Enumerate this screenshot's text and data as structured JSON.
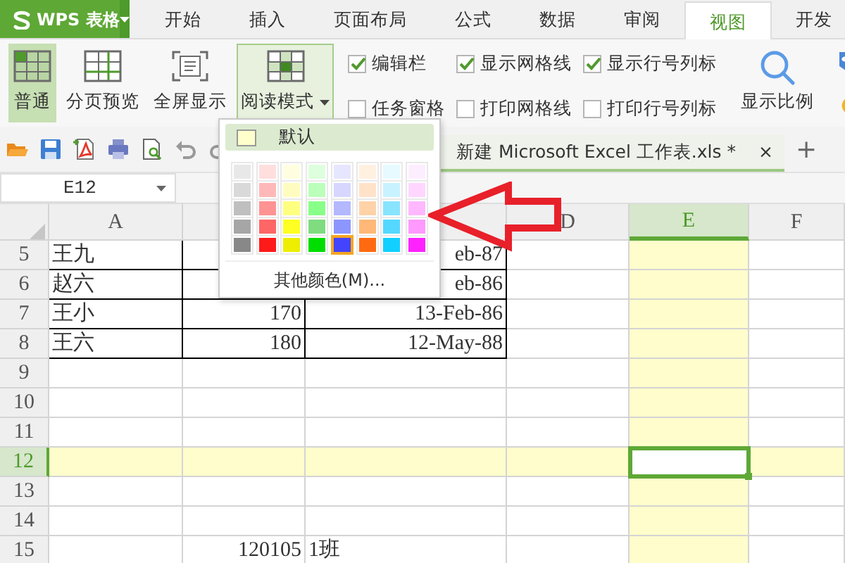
{
  "app": {
    "logo_text": "WPS 表格"
  },
  "menu_tabs": [
    {
      "label": "开始",
      "selected": false
    },
    {
      "label": "插入",
      "selected": false
    },
    {
      "label": "页面布局",
      "selected": false
    },
    {
      "label": "公式",
      "selected": false
    },
    {
      "label": "数据",
      "selected": false
    },
    {
      "label": "审阅",
      "selected": false
    },
    {
      "label": "视图",
      "selected": true
    },
    {
      "label": "开发",
      "selected": false
    }
  ],
  "view_buttons": [
    {
      "kind": "normal",
      "label": "普通",
      "selected": true,
      "expanded": false
    },
    {
      "kind": "page-break",
      "label": "分页预览",
      "selected": false,
      "expanded": false
    },
    {
      "kind": "full-screen",
      "label": "全屏显示",
      "selected": false,
      "expanded": false
    },
    {
      "kind": "reading",
      "label": "阅读模式",
      "selected": false,
      "expanded": true
    }
  ],
  "checkbox_columns": [
    [
      {
        "label": "编辑栏",
        "checked": true
      },
      {
        "label": "任务窗格",
        "checked": false
      }
    ],
    [
      {
        "label": "显示网格线",
        "checked": true
      },
      {
        "label": "打印网格线",
        "checked": false
      }
    ],
    [
      {
        "label": "显示行号列标",
        "checked": true
      },
      {
        "label": "打印行号列标",
        "checked": false
      }
    ]
  ],
  "zoom_button": {
    "label": "显示比例"
  },
  "document_tab": {
    "title": "新建 Microsoft Excel 工作表.xls *",
    "close": "×",
    "add": "+"
  },
  "name_box": {
    "value": "E12"
  },
  "columns": [
    {
      "label": "A",
      "selected": false
    },
    {
      "selected": false
    },
    {
      "selected": false
    },
    {
      "label": "D",
      "selected": false
    },
    {
      "label": "E",
      "selected": true
    },
    {
      "label": "F",
      "selected": false
    }
  ],
  "rows": [
    {
      "label": "5",
      "selected": false,
      "bordered": true,
      "cells": {
        "A": {
          "text": "王九",
          "kind": "text"
        },
        "C": {
          "text": "eb-87",
          "kind": "date"
        }
      }
    },
    {
      "label": "6",
      "selected": false,
      "bordered": true,
      "cells": {
        "A": {
          "text": "赵六",
          "kind": "text"
        },
        "C": {
          "text": "eb-86",
          "kind": "date"
        }
      }
    },
    {
      "label": "7",
      "selected": false,
      "bordered": true,
      "cells": {
        "A": {
          "text": "王小",
          "kind": "text"
        },
        "B": {
          "text": "170",
          "kind": "number"
        },
        "C": {
          "text": "13-Feb-86",
          "kind": "date"
        }
      }
    },
    {
      "label": "8",
      "selected": false,
      "bordered": true,
      "cells": {
        "A": {
          "text": "王六",
          "kind": "text"
        },
        "B": {
          "text": "180",
          "kind": "number"
        },
        "C": {
          "text": "12-May-88",
          "kind": "date"
        }
      }
    },
    {
      "label": "9",
      "selected": false,
      "bordered": false,
      "cells": {}
    },
    {
      "label": "10",
      "selected": false,
      "bordered": false,
      "cells": {}
    },
    {
      "label": "11",
      "selected": false,
      "bordered": false,
      "cells": {}
    },
    {
      "label": "12",
      "selected": true,
      "bordered": false,
      "cells": {}
    },
    {
      "label": "13",
      "selected": false,
      "bordered": false,
      "cells": {}
    },
    {
      "label": "14",
      "selected": false,
      "bordered": false,
      "cells": {}
    },
    {
      "label": "15",
      "selected": false,
      "bordered": false,
      "cells": {
        "B": {
          "text": "120105",
          "kind": "number"
        },
        "C": {
          "text": "1班",
          "kind": "text"
        }
      }
    }
  ],
  "color_menu": {
    "default": {
      "label": "默认",
      "color": "#ffffcc"
    },
    "swatches": [
      {
        "color": "#e8e8e8",
        "selected": false
      },
      {
        "color": "#ffdede",
        "selected": false
      },
      {
        "color": "#ffffe0",
        "selected": false
      },
      {
        "color": "#ddffdd",
        "selected": false
      },
      {
        "color": "#e6e6ff",
        "selected": false
      },
      {
        "color": "#fff0e0",
        "selected": false
      },
      {
        "color": "#e6faff",
        "selected": false
      },
      {
        "color": "#fdeeff",
        "selected": false
      },
      {
        "color": "#d9d9d9",
        "selected": false
      },
      {
        "color": "#ffb8b8",
        "selected": false
      },
      {
        "color": "#fffcbf",
        "selected": false
      },
      {
        "color": "#bbffbb",
        "selected": false
      },
      {
        "color": "#d6d6ff",
        "selected": false
      },
      {
        "color": "#ffe2c8",
        "selected": false
      },
      {
        "color": "#c8f2ff",
        "selected": false
      },
      {
        "color": "#ffd6ff",
        "selected": false
      },
      {
        "color": "#bfbfbf",
        "selected": false
      },
      {
        "color": "#ff9393",
        "selected": false
      },
      {
        "color": "#ffff80",
        "selected": false
      },
      {
        "color": "#88ff88",
        "selected": false
      },
      {
        "color": "#b3b8ff",
        "selected": false
      },
      {
        "color": "#ffd2a8",
        "selected": false
      },
      {
        "color": "#88e4ff",
        "selected": false
      },
      {
        "color": "#ffb8ff",
        "selected": false
      },
      {
        "color": "#a6a6a6",
        "selected": false
      },
      {
        "color": "#ff6666",
        "selected": false
      },
      {
        "color": "#ffff22",
        "selected": false
      },
      {
        "color": "#7fdc7f",
        "selected": false
      },
      {
        "color": "#8c96ff",
        "selected": false
      },
      {
        "color": "#ffb877",
        "selected": false
      },
      {
        "color": "#55d8ff",
        "selected": false
      },
      {
        "color": "#ff99ff",
        "selected": false
      },
      {
        "color": "#888888",
        "selected": false
      },
      {
        "color": "#ff1a1a",
        "selected": false
      },
      {
        "color": "#eeee00",
        "selected": false
      },
      {
        "color": "#00dd00",
        "selected": false
      },
      {
        "color": "#4444ff",
        "selected": true
      },
      {
        "color": "#ff6a11",
        "selected": false
      },
      {
        "color": "#11d0ff",
        "selected": false
      },
      {
        "color": "#ff22ff",
        "selected": false
      }
    ],
    "more": "其他颜色(M)..."
  }
}
